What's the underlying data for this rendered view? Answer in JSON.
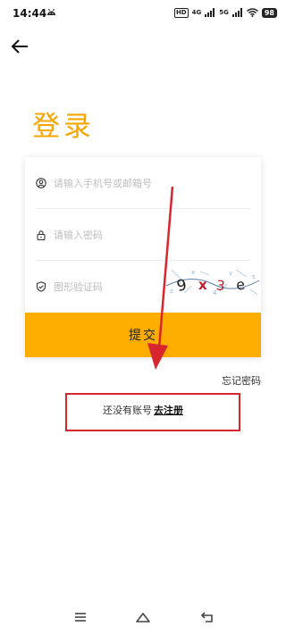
{
  "status_bar": {
    "time": "14:44",
    "hd_badge": "HD",
    "network_4g": "4G",
    "network_5g": "5G",
    "battery": "98",
    "icons": [
      "android-notification-icon",
      "signal-icon",
      "wifi-icon",
      "battery-icon"
    ]
  },
  "header": {
    "back_icon": "arrow-left-icon",
    "title": "登录"
  },
  "form": {
    "account_placeholder": "请输入手机号或邮箱号",
    "account_icon": "user-icon",
    "password_placeholder": "请输入密码",
    "password_icon": "lock-icon",
    "captcha_placeholder": "图形验证码",
    "captcha_icon": "shield-icon",
    "captcha_text": "9x3e",
    "submit_label": "提交",
    "forgot_label": "忘记密码"
  },
  "register": {
    "prompt": "还没有账号",
    "link_label": "去注册"
  },
  "annotation": {
    "color": "#d8262e"
  },
  "nav_bar": {
    "icons": [
      "menu-icon",
      "home-icon",
      "back-icon"
    ]
  },
  "colors": {
    "accent": "#fdac00",
    "title": "#f7a600",
    "annotation": "#d8262e"
  }
}
